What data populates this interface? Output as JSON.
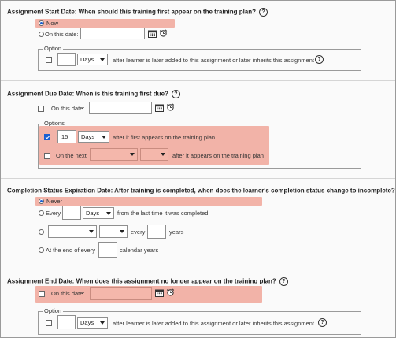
{
  "start": {
    "title": "Assignment Start Date: When should this training first appear on the training plan?",
    "now_label": "Now",
    "on_date_label": "On this date:",
    "option_legend": "Option",
    "days_value": "Days",
    "after_text": "after learner is later added to this assignment or later inherits this assignment"
  },
  "due": {
    "title": "Assignment Due Date: When is this training first due?",
    "on_date_label": "On this date:",
    "options_legend": "Options",
    "number_value": "15",
    "days_value": "Days",
    "after_first_text": "after it first appears on the training plan",
    "on_next_label": "On the next",
    "after_appears_text": "after it appears on the training plan"
  },
  "completion": {
    "title": "Completion Status Expiration Date: After training is completed, when does the learner's completion status change to incomplete?",
    "never_label": "Never",
    "every_label": "Every",
    "days_value": "Days",
    "from_last_text": "from the last time it was completed",
    "every_text": "every",
    "years_text": "years",
    "end_of_every_label": "At the end of every",
    "calendar_years_text": "calendar years"
  },
  "end": {
    "title": "Assignment End Date: When does this assignment no longer appear on the training plan?",
    "on_date_label": "On this date:",
    "option_legend": "Option",
    "days_value": "Days",
    "after_text": "after learner is later added to this assignment or later inherits this assignment"
  },
  "colors": {
    "highlight": "#f2b3a8",
    "radio_selected": "#1b5fd1"
  },
  "icons": [
    "help-icon",
    "calendar-icon",
    "alarm-clock-icon",
    "dropdown-arrow-icon"
  ]
}
